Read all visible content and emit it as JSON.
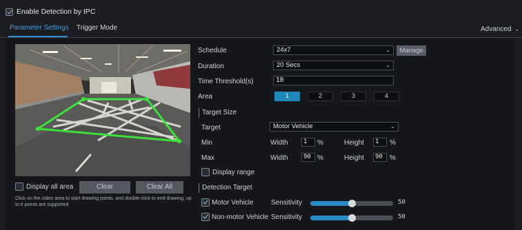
{
  "header": {
    "enable_label": "Enable Detection by IPC",
    "enable_checked": true,
    "tabs": [
      {
        "label": "Parameter Settings",
        "active": true
      },
      {
        "label": "Trigger Mode",
        "active": false
      }
    ],
    "advanced_label": "Advanced"
  },
  "left": {
    "display_all_label": "Display all area",
    "display_all_checked": false,
    "clear_label": "Clear",
    "clear_all_label": "Clear All",
    "hint": "Click on the video area to start drawing points, and double-click to end drawing, up to 6 points are supported"
  },
  "form": {
    "schedule_label": "Schedule",
    "schedule_value": "24x7",
    "manage_label": "Manage",
    "duration_label": "Duration",
    "duration_value": "20 Secs",
    "threshold_label": "Time Threshold(s)",
    "threshold_value": "10",
    "area_label": "Area",
    "area_buttons": [
      "1",
      "2",
      "3",
      "4"
    ],
    "area_active_index": 0,
    "target_size_title": "Target Size",
    "target_label": "Target",
    "target_value": "Motor Vehicle",
    "min_label": "Min",
    "max_label": "Max",
    "width_label": "Width",
    "height_label": "Height",
    "min_width": "1",
    "min_height": "1",
    "max_width": "90",
    "max_height": "90",
    "percent": "%",
    "display_range_label": "Display range",
    "display_range_checked": false,
    "detection_target_title": "Detection Target",
    "sensitivity_label": "Sensitivity",
    "targets": [
      {
        "label": "Motor Vehicle",
        "checked": true,
        "sensitivity": "50",
        "level": 0.5
      },
      {
        "label": "Non-motor Vehicle",
        "checked": true,
        "sensitivity": "50",
        "level": 0.5
      }
    ]
  },
  "colors": {
    "accent": "#2f8ad1",
    "area_active": "#1c87b8",
    "detection_line": "#3ee03a"
  }
}
